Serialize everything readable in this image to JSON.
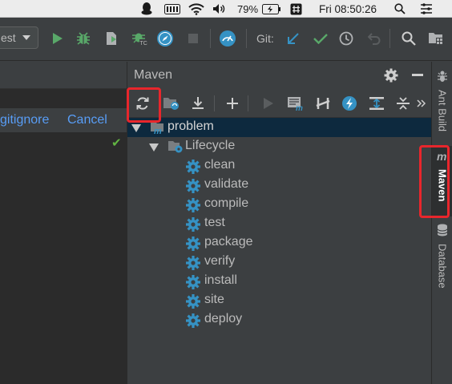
{
  "menubar": {
    "battery_percent": "79%",
    "clock": "Fri 08:50:26",
    "icons": [
      "qq-penguin-icon",
      "keyboard-icon",
      "wifi-icon",
      "volume-icon",
      "battery-charging-icon",
      "hashtag-icon",
      "spotlight-search-icon",
      "control-center-icon"
    ]
  },
  "toolbar": {
    "run_config_label": "est",
    "git_label": "Git:",
    "icons": [
      "run-icon",
      "debug-icon",
      "coverage-icon",
      "profile-icon",
      "tc-debug-icon",
      "compass-icon",
      "stop-icon",
      "dashboard-icon",
      "git-update-icon",
      "git-commit-icon",
      "history-icon",
      "rollback-icon",
      "search-icon",
      "project-structure-icon"
    ],
    "colors": {
      "run": "#59a869",
      "debug": "#59a869",
      "blue": "#3592c4",
      "git_update": "#3592c4",
      "git_commit": "#59a869"
    }
  },
  "left_pane": {
    "gitignore_link": "gitignore",
    "cancel_link": "Cancel",
    "check_mark": "✔"
  },
  "maven": {
    "title": "Maven",
    "toolbar_icons": [
      "reimport-icon",
      "generate-sources-icon",
      "download-icon",
      "add-icon",
      "run-icon",
      "execute-goal-icon",
      "skip-tests-icon",
      "offline-icon",
      "show-dependencies-icon",
      "collapse-all-icon",
      "more-icon"
    ],
    "tree": {
      "project": "problem",
      "lifecycle": "Lifecycle",
      "goals": [
        "clean",
        "validate",
        "compile",
        "test",
        "package",
        "verify",
        "install",
        "site",
        "deploy"
      ]
    },
    "colors": {
      "selection": "#0d293e",
      "gear": "#3592c4",
      "highlight": "#e8262c"
    }
  },
  "side_stripe": {
    "tabs": [
      {
        "label": "Ant Build",
        "icon": "ant-icon"
      },
      {
        "label": "Maven",
        "icon": "maven-m-icon"
      },
      {
        "label": "Database",
        "icon": "database-icon"
      }
    ]
  }
}
